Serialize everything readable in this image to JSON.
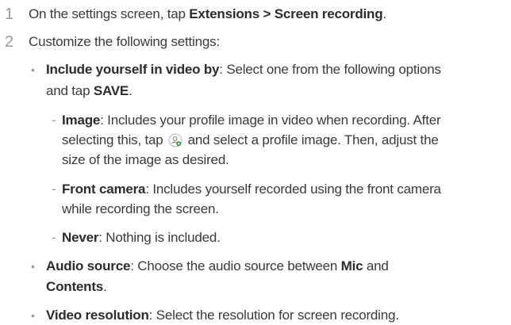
{
  "steps": [
    {
      "number": "1",
      "prefix": "On the settings screen, tap ",
      "bold1": "Extensions",
      "sep": " > ",
      "bold2": "Screen recording",
      "suffix": "."
    },
    {
      "number": "2",
      "text": "Customize the following settings:"
    }
  ],
  "include_yourself": {
    "bold": "Include yourself in video by",
    "text_line1": ": Select one from the following options",
    "text_line2_prefix": "and tap ",
    "save": "SAVE",
    "text_line2_suffix": "."
  },
  "image_option": {
    "bold": "Image",
    "text_line1": ": Includes your profile image in video when recording. After",
    "text_line2_prefix": "selecting this, tap ",
    "text_line2_suffix": " and select a profile image. Then, adjust the",
    "text_line3": "size of the image as desired."
  },
  "front_camera_option": {
    "bold": "Front camera",
    "text_line1": ": Includes yourself recorded using the front camera",
    "text_line2": "while recording the screen."
  },
  "never_option": {
    "bold": "Never",
    "text": ": Nothing is included."
  },
  "audio_source": {
    "bold": "Audio source",
    "text_line1": ": Choose the audio source between ",
    "mic": "Mic",
    "and": " and",
    "contents": "Contents",
    "period": "."
  },
  "video_resolution": {
    "bold": "Video resolution",
    "text": ": Select the resolution for screen recording."
  },
  "glyphs": {
    "bullet": "•",
    "dash": "-"
  },
  "icons": {
    "profile": "profile-add-icon"
  },
  "colors": {
    "text": "#3a3a3a",
    "number": "#9a9a9a",
    "icon_green": "#2e9a3c"
  }
}
